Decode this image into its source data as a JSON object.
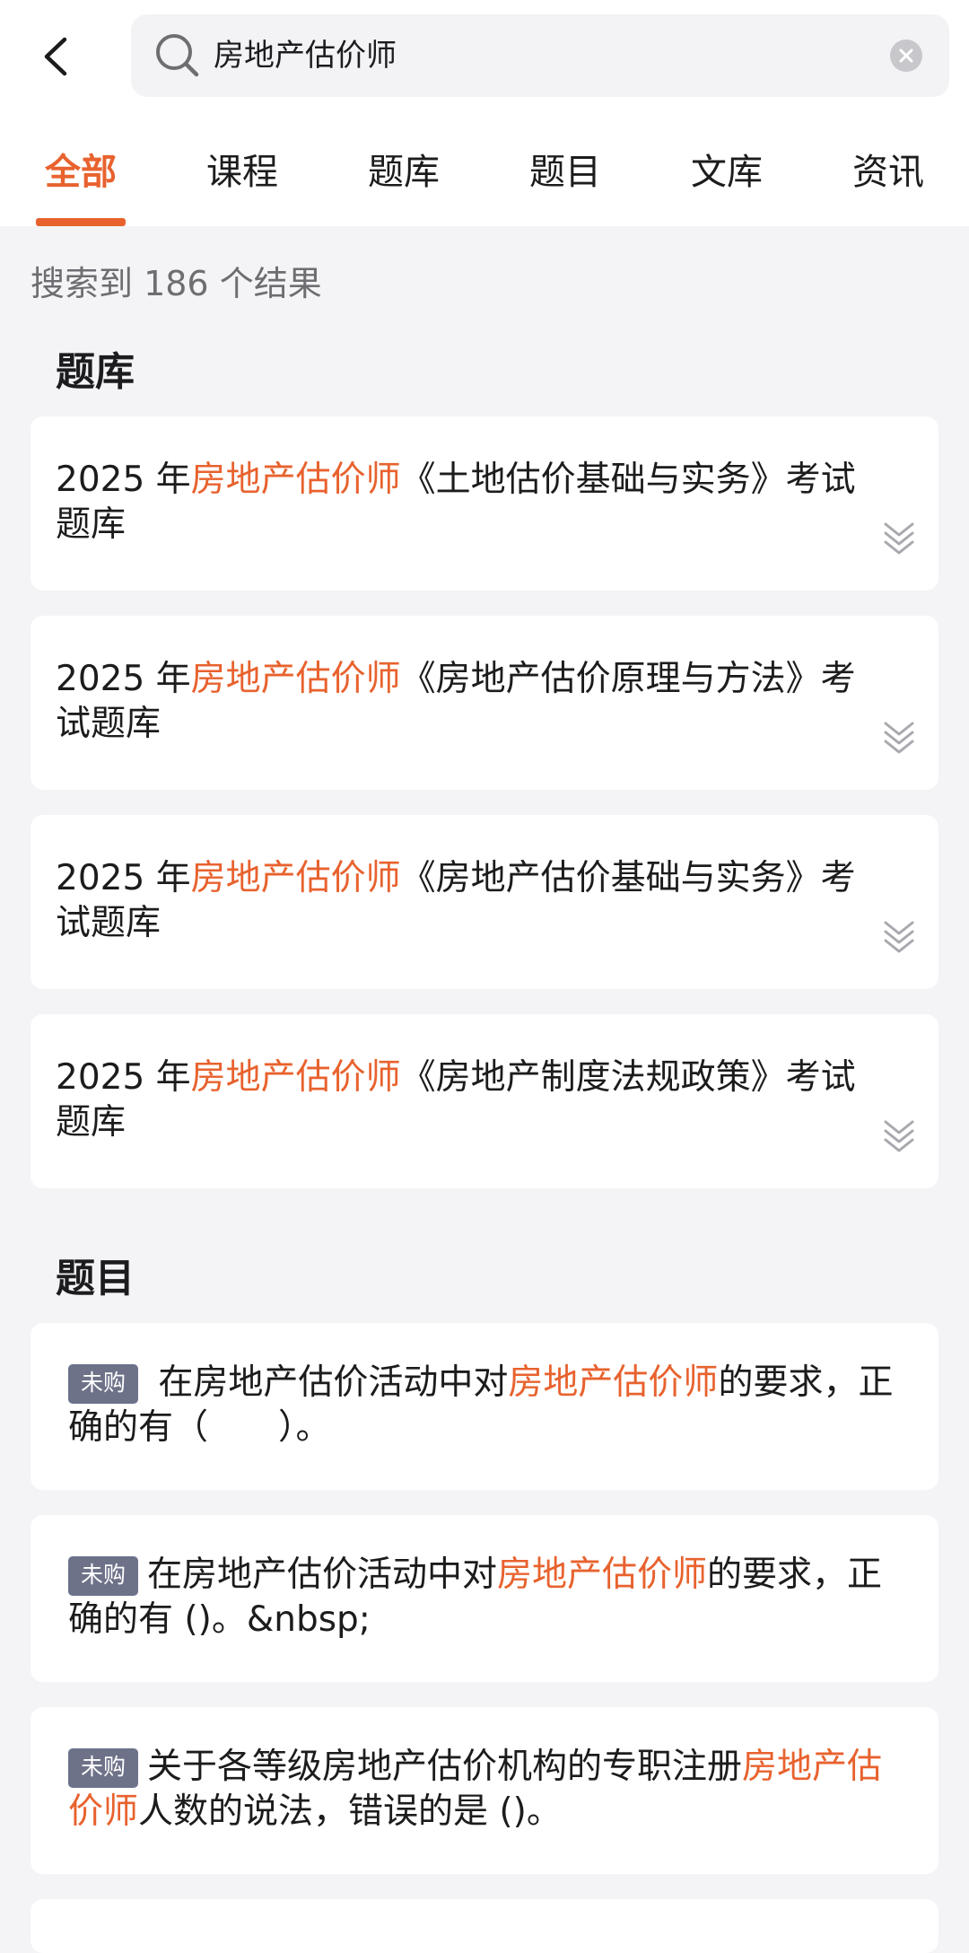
{
  "search": {
    "query": "房地产估价师"
  },
  "tabs": [
    {
      "label": "全部",
      "active": true
    },
    {
      "label": "课程"
    },
    {
      "label": "题库"
    },
    {
      "label": "题目"
    },
    {
      "label": "文库"
    },
    {
      "label": "资讯"
    }
  ],
  "result_count": "搜索到 186 个结果",
  "sections": {
    "bank_title": "题库",
    "question_title": "题目"
  },
  "banks": [
    {
      "prefix": "2025 年",
      "highlight": "房地产估价师",
      "suffix": "《土地估价基础与实务》考试题库"
    },
    {
      "prefix": "2025 年",
      "highlight": "房地产估价师",
      "suffix": "《房地产估价原理与方法》考试题库"
    },
    {
      "prefix": "2025 年",
      "highlight": "房地产估价师",
      "suffix": "《房地产估价基础与实务》考试题库"
    },
    {
      "prefix": "2025 年",
      "highlight": "房地产估价师",
      "suffix": "《房地产制度法规政策》考试题库"
    }
  ],
  "questions": [
    {
      "badge": "未购",
      "before": " 在房地产估价活动中对",
      "highlight": "房地产估价师",
      "after": "的要求，正确的有（　　）。"
    },
    {
      "badge": "未购",
      "before": "在房地产估价活动中对",
      "highlight": "房地产估价师",
      "after": "的要求，正确的有 ()。&nbsp;"
    },
    {
      "badge": "未购",
      "before": "关于各等级房地产估价机构的专职注册",
      "highlight": "房地产估价师",
      "after": "人数的说法，错误的是 ()。"
    }
  ],
  "colors": {
    "accent": "#e8622e",
    "badge_bg": "#6e7288",
    "page_bg": "#f4f4f6"
  },
  "icons": {
    "back": "chevron-left-icon",
    "search": "search-icon",
    "clear": "clear-icon",
    "expand": "double-chevron-down-icon"
  }
}
